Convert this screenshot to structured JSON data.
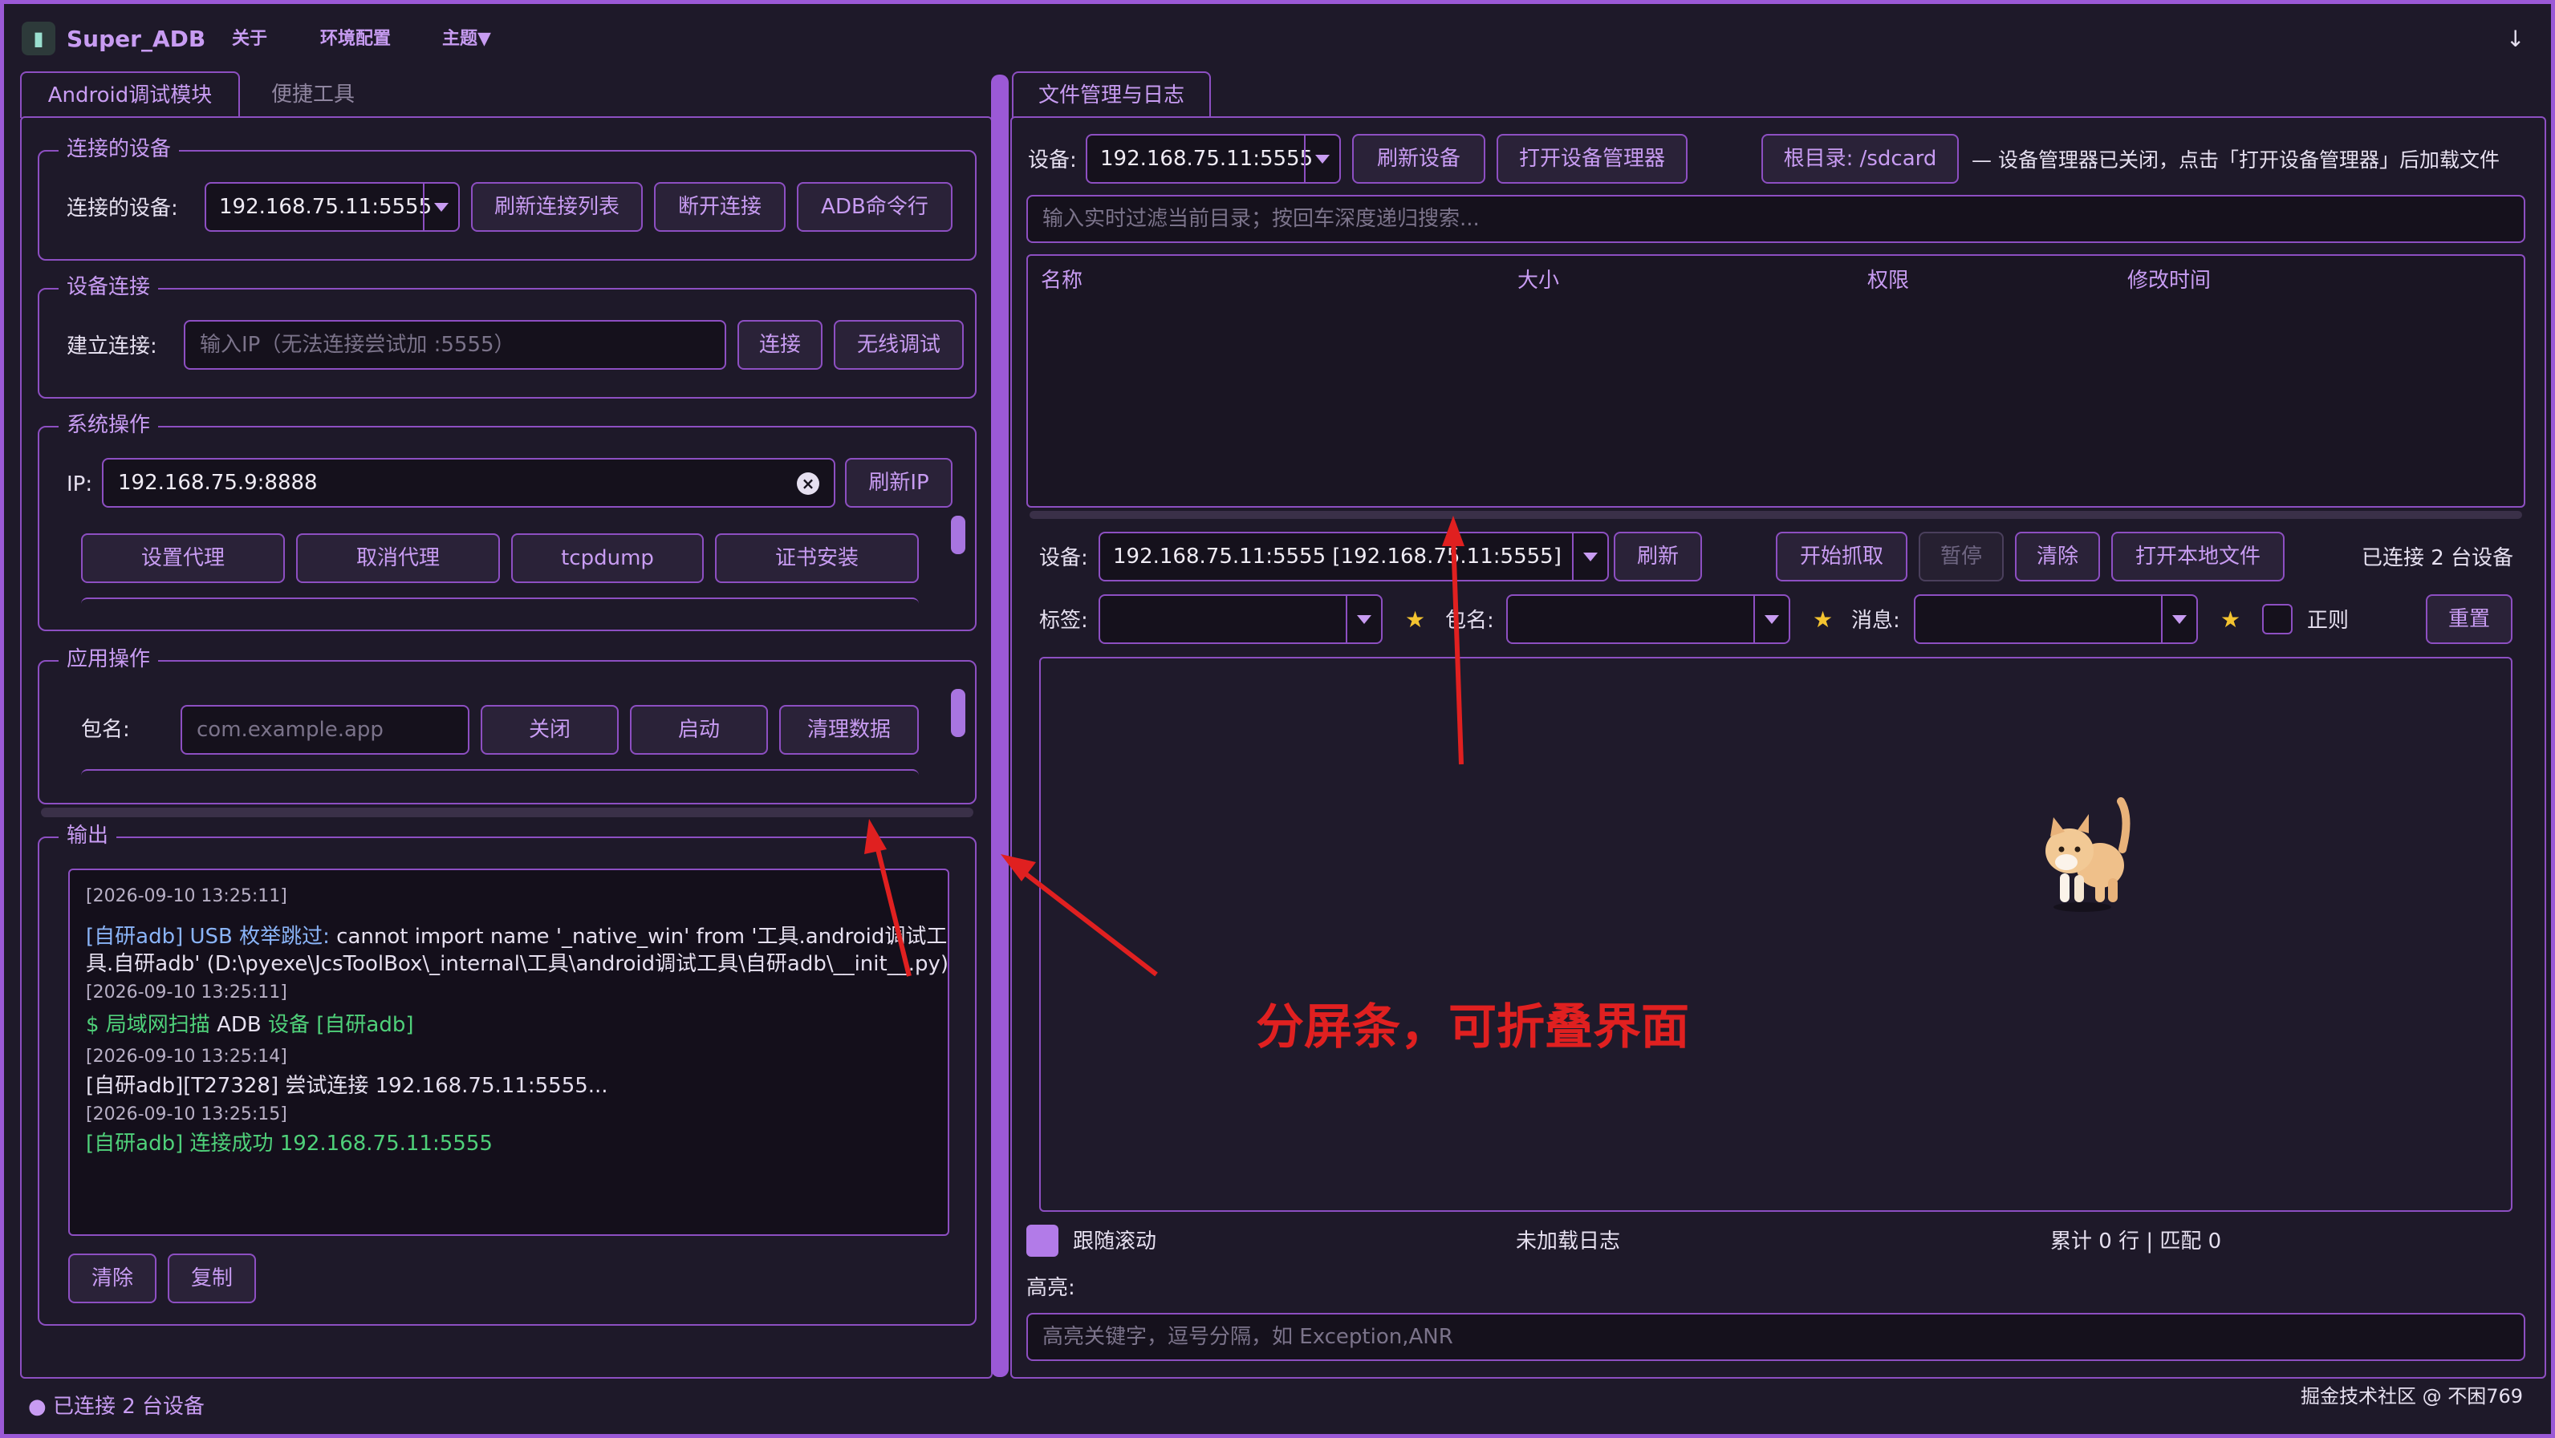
{
  "menubar": {
    "app_name": "Super_ADB",
    "menu_about": "关于",
    "menu_env": "环境配置",
    "menu_theme": "主题▼",
    "right_icon": "↓"
  },
  "left": {
    "tab_active": "Android调试模块",
    "tab_inactive": "便捷工具",
    "connected": {
      "title": "连接的设备",
      "label": "连接的设备:",
      "device": "192.168.75.11:5555",
      "refresh_btn": "刷新连接列表",
      "disconnect_btn": "断开连接",
      "adb_btn": "ADB命令行"
    },
    "connect": {
      "title": "设备连接",
      "label": "建立连接:",
      "placeholder": "输入IP（无法连接尝试加 :5555）",
      "connect_btn": "连接",
      "wireless_btn": "无线调试"
    },
    "system": {
      "title": "系统操作",
      "ip_label": "IP:",
      "ip_value": "192.168.75.9:8888",
      "refresh_ip_btn": "刷新IP",
      "proxy_btn": "设置代理",
      "cancel_proxy_btn": "取消代理",
      "tcpdump_btn": "tcpdump",
      "cert_btn": "证书安装"
    },
    "app": {
      "title": "应用操作",
      "pkg_label": "包名:",
      "pkg_placeholder": "com.example.app",
      "close_btn": "关闭",
      "start_btn": "启动",
      "clear_btn": "清理数据"
    },
    "output": {
      "title": "输出",
      "lines": [
        {
          "ts": "[2026-09-10 13:25:11]"
        },
        {
          "tag": "[自研adb] USB 枚举跳过:",
          "text": " cannot import name '_native_win' from '工具.android调试工"
        },
        {
          "text": "具.自研adb' (D:\\pyexe\\JcsToolBox\\_internal\\工具\\android调试工具\\自研adb\\__init__.py)"
        },
        {
          "ts": "[2026-09-10 13:25:11]"
        },
        {
          "green": "$ 局域网扫描 ",
          "text": "ADB",
          "green2": " 设备 [自研adb]"
        },
        {
          "ts": "[2026-09-10 13:25:14]"
        },
        {
          "text": "[自研adb][T27328] 尝试连接 192.168.75.11:5555..."
        },
        {
          "ts": "[2026-09-10 13:25:15]"
        },
        {
          "green": "[自研adb] 连接成功 192.168.75.11:5555"
        }
      ],
      "clear_btn": "清除",
      "copy_btn": "复制"
    }
  },
  "right": {
    "tab": "文件管理与日志",
    "file": {
      "device_label": "设备:",
      "device": "192.168.75.11:5555",
      "refresh_btn": "刷新设备",
      "open_mgr_btn": "打开设备管理器",
      "root_btn": "根目录: /sdcard",
      "status": "— 设备管理器已关闭，点击「打开设备管理器」后加载文件",
      "filter_placeholder": "输入实时过滤当前目录；按回车深度递归搜索...",
      "columns": [
        "名称",
        "大小",
        "权限",
        "修改时间"
      ]
    },
    "log": {
      "device_label": "设备:",
      "device": "192.168.75.11:5555  [192.168.75.11:5555]",
      "refresh_btn": "刷新",
      "start_btn": "开始抓取",
      "pause_btn": "暂停",
      "clear_btn": "清除",
      "open_local_btn": "打开本地文件",
      "connected_count": "已连接 2 台设备",
      "tag_label": "标签:",
      "pkg_label": "包名:",
      "msg_label": "消息:",
      "regex_label": "正则",
      "reset_btn": "重置",
      "follow_label": "跟随滚动",
      "status": "未加载日志",
      "counter": "累计 0 行 | 匹配 0",
      "highlight_label": "高亮:",
      "highlight_placeholder": "高亮关键字，逗号分隔，如 Exception,ANR"
    }
  },
  "annotation": "分屏条，可折叠界面",
  "statusbar": {
    "left": "● 已连接 2 台设备",
    "right": "掘金技术社区 @ 不困769"
  },
  "colors": {
    "accent": "#9b59d6",
    "background": "#1e1929",
    "annotation": "#e02020",
    "log_green": "#4fd17a",
    "log_tag": "#8ab4f8"
  }
}
